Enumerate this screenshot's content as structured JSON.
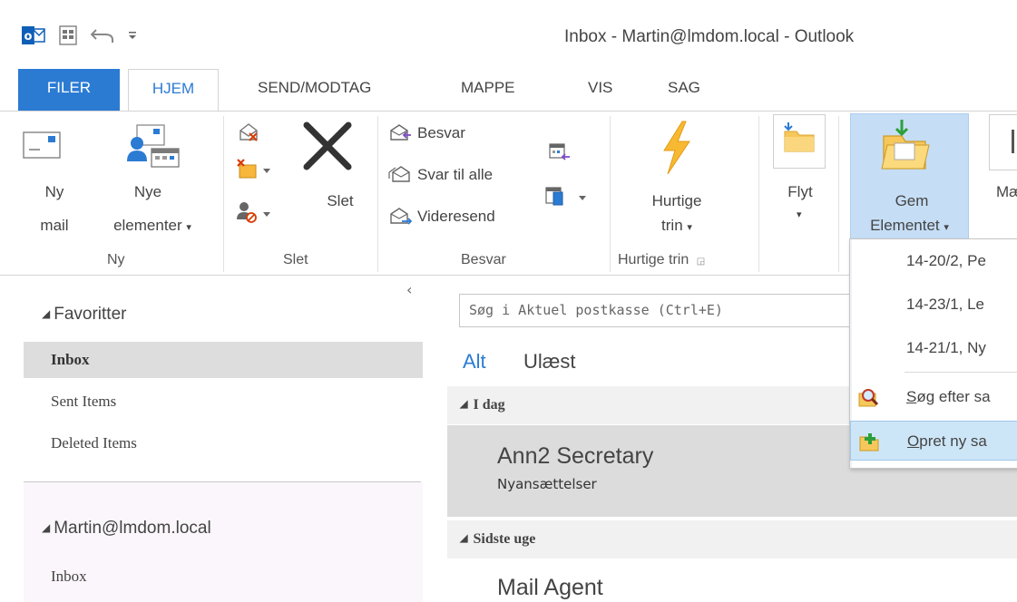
{
  "window": {
    "title": "Inbox - Martin@lmdom.local - Outlook"
  },
  "tabs": [
    {
      "label": "FILER"
    },
    {
      "label": "HJEM"
    },
    {
      "label": "SEND/MODTAG"
    },
    {
      "label": "MAPPE"
    },
    {
      "label": "VIS"
    },
    {
      "label": "SAG"
    }
  ],
  "ribbon": {
    "ny": {
      "new_mail_line1": "Ny",
      "new_mail_line2": "mail",
      "new_items_line1": "Nye",
      "new_items_line2": "elementer",
      "group_label": "Ny"
    },
    "slet": {
      "delete_label": "Slet",
      "group_label": "Slet"
    },
    "besvar": {
      "reply": "Besvar",
      "reply_all": "Svar til alle",
      "forward": "Videresend",
      "group_label": "Besvar"
    },
    "hurtige": {
      "line1": "Hurtige",
      "line2": "trin",
      "group_label": "Hurtige trin"
    },
    "flyt": {
      "label": "Flyt"
    },
    "gem": {
      "line1": "Gem",
      "line2": "Elementet"
    },
    "cut": {
      "line1": "Mæ"
    }
  },
  "folder_pane": {
    "favorites_label": "Favoritter",
    "favorites": [
      {
        "label": "Inbox",
        "selected": true
      },
      {
        "label": "Sent Items",
        "selected": false
      },
      {
        "label": "Deleted Items",
        "selected": false
      }
    ],
    "account_label": "Martin@lmdom.local",
    "account_items": [
      {
        "label": "Inbox"
      }
    ]
  },
  "mail_list": {
    "search_placeholder": "Søg i Aktuel postkasse (Ctrl+E)",
    "filter_all": "Alt",
    "filter_unread": "Ulæst",
    "groups": [
      {
        "header": "I dag",
        "items": [
          {
            "from": "Ann2 Secretary",
            "subject": "Nyansættelser",
            "selected": true
          }
        ]
      },
      {
        "header": "Sidste uge",
        "items": [
          {
            "from": "Mail Agent",
            "subject": "",
            "selected": false
          }
        ]
      }
    ]
  },
  "dropdown": {
    "recent": [
      "14-20/2, Pe",
      "14-23/1, Le",
      "14-21/1, Ny"
    ],
    "search_prefix": "S",
    "search_rest": "øg efter sa",
    "create_prefix": "O",
    "create_rest": "pret ny sa"
  },
  "colors": {
    "accent": "#2b7bd3",
    "selection": "#dddddd",
    "ribbon_highlight": "#c5def5",
    "dropdown_highlight": "#cde6f7"
  }
}
